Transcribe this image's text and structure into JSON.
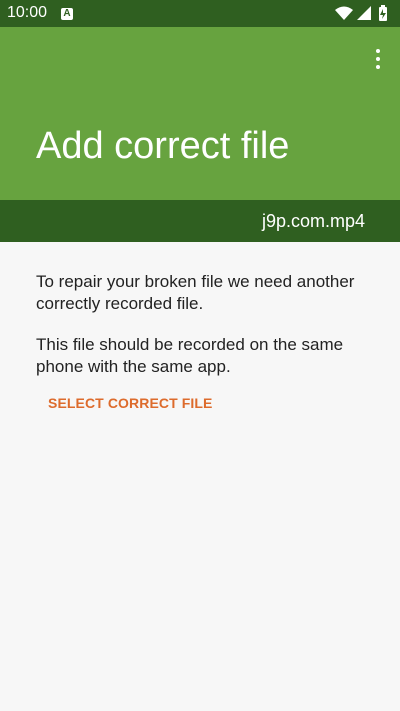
{
  "status_bar": {
    "time": "10:00",
    "notification_icon": "android-notification-icon",
    "icons": [
      "wifi-icon",
      "signal-icon",
      "battery-icon"
    ]
  },
  "app_bar": {
    "title": "Add correct file",
    "menu_icon": "overflow-menu-icon"
  },
  "file": {
    "name": "j9p.com.mp4"
  },
  "content": {
    "paragraph1": "To repair your broken file we need another correctly recorded file.",
    "paragraph2": "This file should be recorded on the same phone with the same app.",
    "select_button": "SELECT CORRECT FILE"
  },
  "colors": {
    "status_bar": "#2f5f20",
    "app_bar": "#67a33f",
    "file_strip": "#2f5f20",
    "action": "#dd6b2c",
    "background": "#f7f7f7"
  }
}
